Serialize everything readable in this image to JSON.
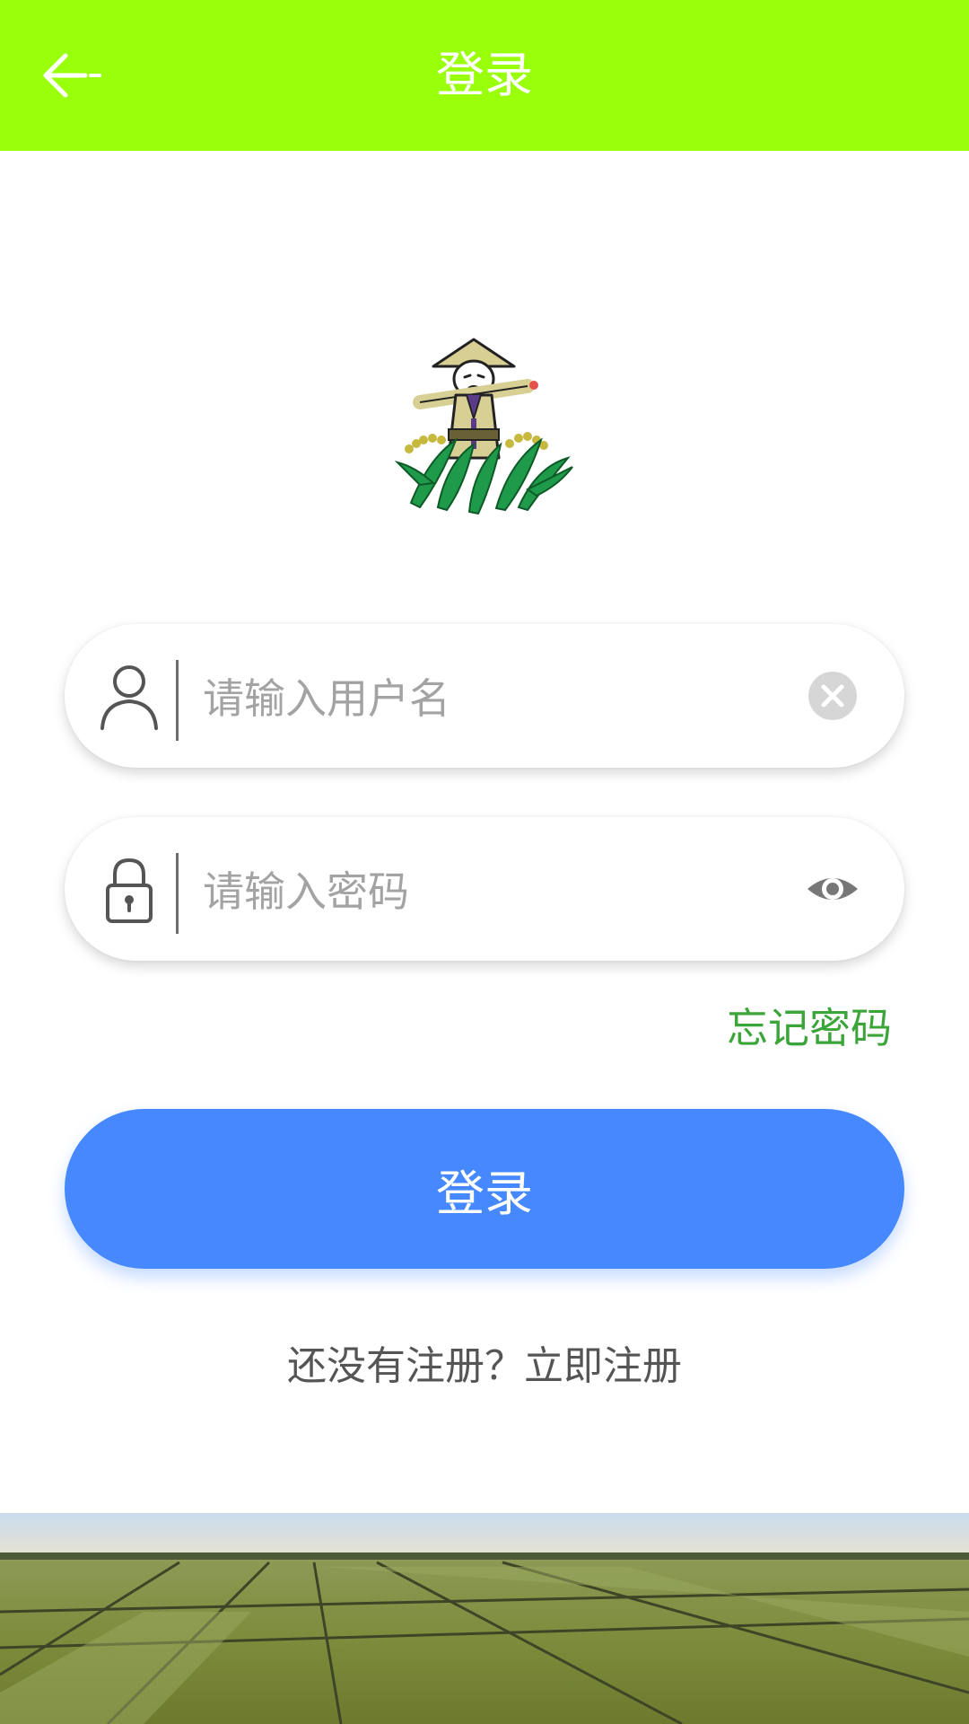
{
  "header": {
    "title": "登录",
    "back_icon": "arrow-left-icon",
    "background_color": "#99ff0a"
  },
  "logo": {
    "icon": "farmer-scarecrow-logo"
  },
  "username": {
    "placeholder": "请输入用户名",
    "value": "",
    "icon": "user-icon",
    "action_icon": "clear-icon"
  },
  "password": {
    "placeholder": "请输入密码",
    "value": "",
    "icon": "lock-icon",
    "action_icon": "eye-icon"
  },
  "forgot_password": "忘记密码",
  "login_button": "登录",
  "register_link": "还没有注册？立即注册",
  "colors": {
    "accent_green": "#3ba53a",
    "button_blue": "#4588ff"
  },
  "banner": {
    "image": "rice-field-landscape"
  }
}
